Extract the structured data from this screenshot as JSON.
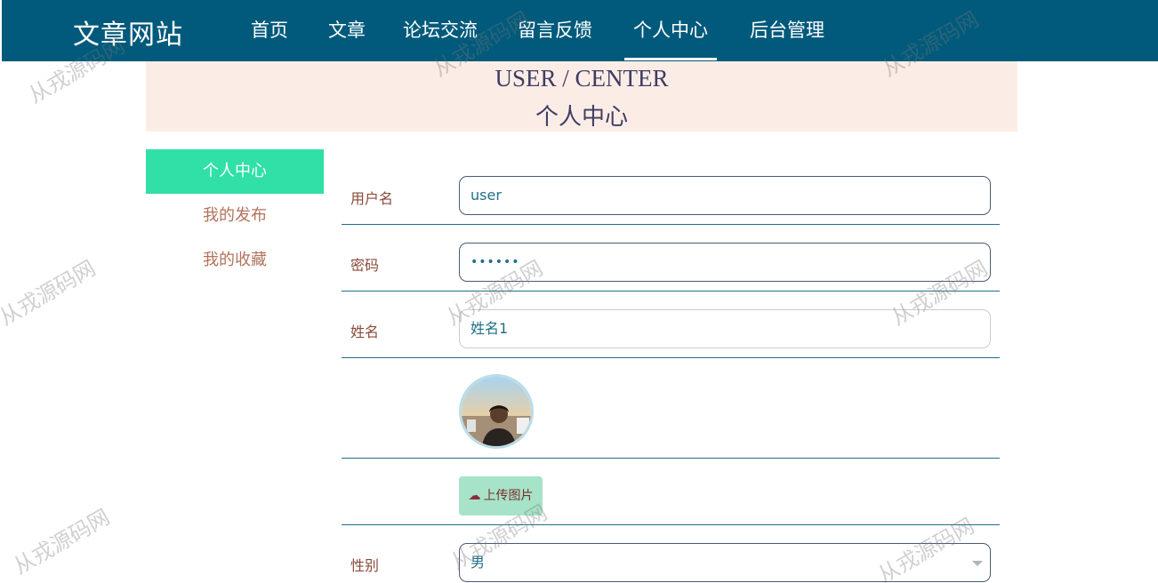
{
  "brand": "文章网站",
  "nav": [
    "首页",
    "文章",
    "论坛交流",
    "留言反馈",
    "个人中心",
    "后台管理"
  ],
  "banner": {
    "en": "USER / CENTER",
    "cn": "个人中心"
  },
  "sidebar": [
    "个人中心",
    "我的发布",
    "我的收藏"
  ],
  "form": {
    "username_label": "用户名",
    "username_value": "user",
    "password_label": "密码",
    "password_value": "••••••",
    "name_label": "姓名",
    "name_value": "姓名1",
    "upload_label": "上传图片",
    "gender_label": "性别",
    "gender_value": "男"
  },
  "watermark": "从戎源码网",
  "colors": {
    "nav_bg": "#015a7b",
    "active_menu": "#30e0a7",
    "banner_bg": "#fbede6"
  }
}
